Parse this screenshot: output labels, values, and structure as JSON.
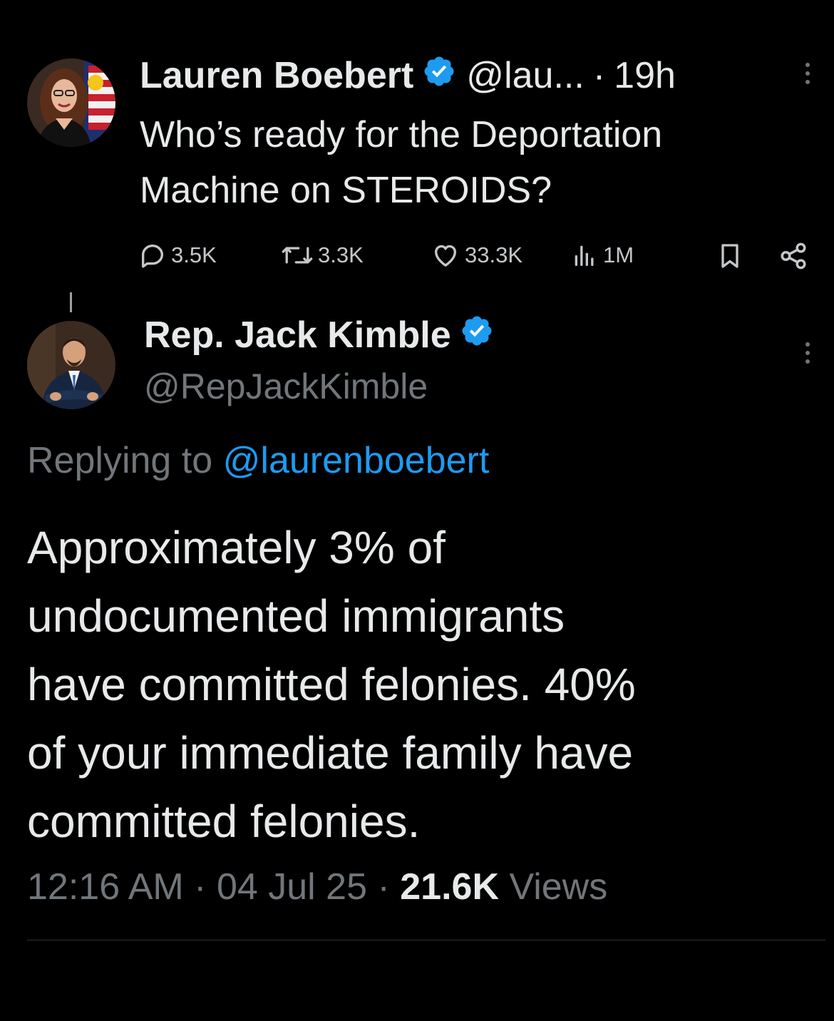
{
  "original_tweet": {
    "author_name": "Lauren Boebert",
    "handle": "@lau...",
    "separator": "·",
    "time": "19h",
    "text_line1": "Who’s ready for the Deportation",
    "text_line2": "Machine on STEROIDS?",
    "stats": {
      "replies": "3.5K",
      "retweets": "3.3K",
      "likes": "33.3K",
      "views": "1M"
    }
  },
  "reply_tweet": {
    "author_name": "Rep. Jack Kimble",
    "handle": "@RepJackKimble",
    "replying_prefix": "Replying to",
    "replying_handle": "@laurenboebert",
    "text_lines": [
      "Approximately 3% of",
      "undocumented immigrants",
      "have committed felonies. 40%",
      "of your immediate family have",
      "committed felonies."
    ],
    "timestamp": "12:16 AM",
    "date": "04 Jul 25",
    "separator": "·",
    "view_count": "21.6K",
    "views_label": "Views"
  },
  "colors": {
    "background": "#000000",
    "text": "#e7e9ea",
    "muted": "#71767b",
    "link": "#1d9bf0",
    "verified": "#1d9bf0"
  }
}
